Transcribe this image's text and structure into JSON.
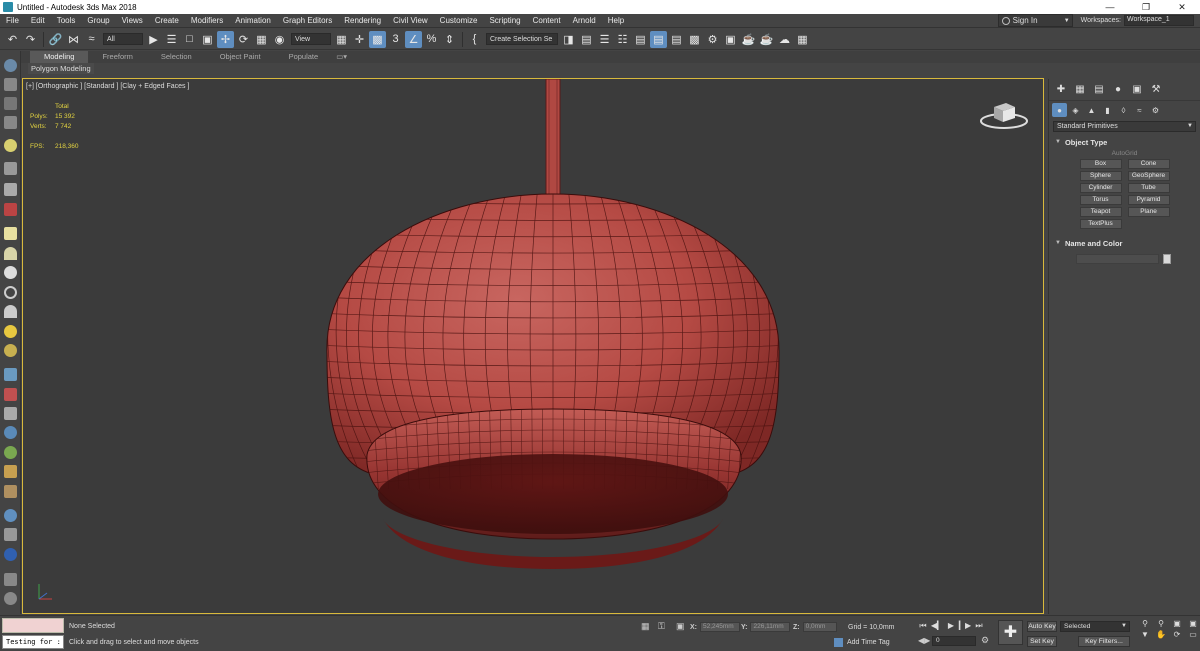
{
  "window": {
    "title": "Untitled - Autodesk 3ds Max 2018",
    "minimize": "—",
    "restore": "❐",
    "close": "✕"
  },
  "menu": [
    "File",
    "Edit",
    "Tools",
    "Group",
    "Views",
    "Create",
    "Modifiers",
    "Animation",
    "Graph Editors",
    "Rendering",
    "Civil View",
    "Customize",
    "Scripting",
    "Content",
    "Arnold",
    "Help"
  ],
  "account": {
    "signin_label": "Sign In",
    "workspaces_label": "Workspaces:",
    "workspace_value": "Workspace_1"
  },
  "toolbar": {
    "selection_filter": "All",
    "ref_coord": "View",
    "named_selection": "Create Selection Se"
  },
  "ribbon": {
    "tabs": [
      "Modeling",
      "Freeform",
      "Selection",
      "Object Paint",
      "Populate"
    ],
    "active_sub": "Polygon Modeling"
  },
  "viewport": {
    "label": "[+] [Orthographic ] [Standard ] [Clay + Edged Faces ]",
    "stats": {
      "total_label": "Total",
      "polys_label": "Polys:",
      "polys_value": "15 392",
      "verts_label": "Verts:",
      "verts_value": "7 742",
      "fps_label": "FPS:",
      "fps_value": "218,360"
    },
    "object_color": "#b8403a",
    "border_color": "#d8b93c"
  },
  "command_panel": {
    "dropdown": "Standard Primitives",
    "object_type_title": "Object Type",
    "autogrid": "AutoGrid",
    "primitives": [
      "Box",
      "Cone",
      "Sphere",
      "GeoSphere",
      "Cylinder",
      "Tube",
      "Torus",
      "Pyramid",
      "Teapot",
      "Plane",
      "TextPlus"
    ],
    "name_color_title": "Name and Color"
  },
  "status": {
    "maxscript_text": "Testing for :",
    "selection": "None Selected",
    "prompt": "Click and drag to select and move objects",
    "x_label": "X:",
    "x_value": "52,245mm",
    "y_label": "Y:",
    "y_value": "226,11mm",
    "z_label": "Z:",
    "z_value": "0,0mm",
    "grid": "Grid = 10,0mm",
    "add_time_tag": "Add Time Tag",
    "frame": "0",
    "auto_key": "Auto Key",
    "set_key": "Set Key",
    "key_mode": "Selected",
    "key_filters": "Key Filters..."
  }
}
